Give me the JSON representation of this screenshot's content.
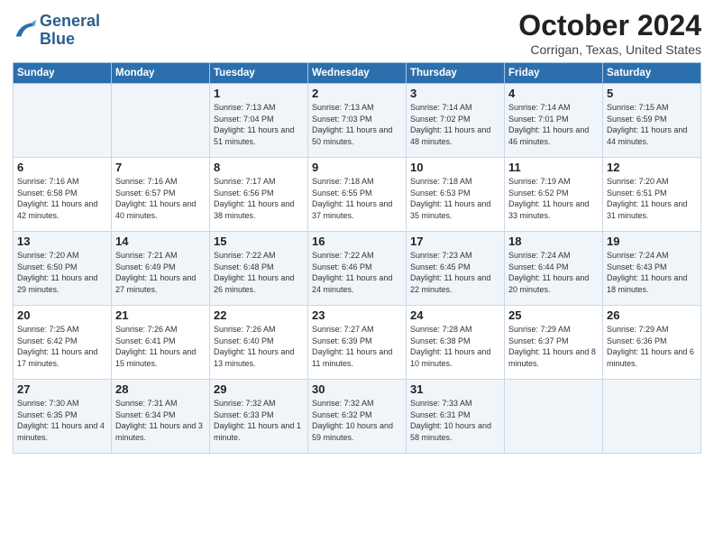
{
  "logo": {
    "line1": "General",
    "line2": "Blue"
  },
  "title": "October 2024",
  "subtitle": "Corrigan, Texas, United States",
  "days_of_week": [
    "Sunday",
    "Monday",
    "Tuesday",
    "Wednesday",
    "Thursday",
    "Friday",
    "Saturday"
  ],
  "weeks": [
    [
      {
        "num": "",
        "info": ""
      },
      {
        "num": "",
        "info": ""
      },
      {
        "num": "1",
        "info": "Sunrise: 7:13 AM\nSunset: 7:04 PM\nDaylight: 11 hours and 51 minutes."
      },
      {
        "num": "2",
        "info": "Sunrise: 7:13 AM\nSunset: 7:03 PM\nDaylight: 11 hours and 50 minutes."
      },
      {
        "num": "3",
        "info": "Sunrise: 7:14 AM\nSunset: 7:02 PM\nDaylight: 11 hours and 48 minutes."
      },
      {
        "num": "4",
        "info": "Sunrise: 7:14 AM\nSunset: 7:01 PM\nDaylight: 11 hours and 46 minutes."
      },
      {
        "num": "5",
        "info": "Sunrise: 7:15 AM\nSunset: 6:59 PM\nDaylight: 11 hours and 44 minutes."
      }
    ],
    [
      {
        "num": "6",
        "info": "Sunrise: 7:16 AM\nSunset: 6:58 PM\nDaylight: 11 hours and 42 minutes."
      },
      {
        "num": "7",
        "info": "Sunrise: 7:16 AM\nSunset: 6:57 PM\nDaylight: 11 hours and 40 minutes."
      },
      {
        "num": "8",
        "info": "Sunrise: 7:17 AM\nSunset: 6:56 PM\nDaylight: 11 hours and 38 minutes."
      },
      {
        "num": "9",
        "info": "Sunrise: 7:18 AM\nSunset: 6:55 PM\nDaylight: 11 hours and 37 minutes."
      },
      {
        "num": "10",
        "info": "Sunrise: 7:18 AM\nSunset: 6:53 PM\nDaylight: 11 hours and 35 minutes."
      },
      {
        "num": "11",
        "info": "Sunrise: 7:19 AM\nSunset: 6:52 PM\nDaylight: 11 hours and 33 minutes."
      },
      {
        "num": "12",
        "info": "Sunrise: 7:20 AM\nSunset: 6:51 PM\nDaylight: 11 hours and 31 minutes."
      }
    ],
    [
      {
        "num": "13",
        "info": "Sunrise: 7:20 AM\nSunset: 6:50 PM\nDaylight: 11 hours and 29 minutes."
      },
      {
        "num": "14",
        "info": "Sunrise: 7:21 AM\nSunset: 6:49 PM\nDaylight: 11 hours and 27 minutes."
      },
      {
        "num": "15",
        "info": "Sunrise: 7:22 AM\nSunset: 6:48 PM\nDaylight: 11 hours and 26 minutes."
      },
      {
        "num": "16",
        "info": "Sunrise: 7:22 AM\nSunset: 6:46 PM\nDaylight: 11 hours and 24 minutes."
      },
      {
        "num": "17",
        "info": "Sunrise: 7:23 AM\nSunset: 6:45 PM\nDaylight: 11 hours and 22 minutes."
      },
      {
        "num": "18",
        "info": "Sunrise: 7:24 AM\nSunset: 6:44 PM\nDaylight: 11 hours and 20 minutes."
      },
      {
        "num": "19",
        "info": "Sunrise: 7:24 AM\nSunset: 6:43 PM\nDaylight: 11 hours and 18 minutes."
      }
    ],
    [
      {
        "num": "20",
        "info": "Sunrise: 7:25 AM\nSunset: 6:42 PM\nDaylight: 11 hours and 17 minutes."
      },
      {
        "num": "21",
        "info": "Sunrise: 7:26 AM\nSunset: 6:41 PM\nDaylight: 11 hours and 15 minutes."
      },
      {
        "num": "22",
        "info": "Sunrise: 7:26 AM\nSunset: 6:40 PM\nDaylight: 11 hours and 13 minutes."
      },
      {
        "num": "23",
        "info": "Sunrise: 7:27 AM\nSunset: 6:39 PM\nDaylight: 11 hours and 11 minutes."
      },
      {
        "num": "24",
        "info": "Sunrise: 7:28 AM\nSunset: 6:38 PM\nDaylight: 11 hours and 10 minutes."
      },
      {
        "num": "25",
        "info": "Sunrise: 7:29 AM\nSunset: 6:37 PM\nDaylight: 11 hours and 8 minutes."
      },
      {
        "num": "26",
        "info": "Sunrise: 7:29 AM\nSunset: 6:36 PM\nDaylight: 11 hours and 6 minutes."
      }
    ],
    [
      {
        "num": "27",
        "info": "Sunrise: 7:30 AM\nSunset: 6:35 PM\nDaylight: 11 hours and 4 minutes."
      },
      {
        "num": "28",
        "info": "Sunrise: 7:31 AM\nSunset: 6:34 PM\nDaylight: 11 hours and 3 minutes."
      },
      {
        "num": "29",
        "info": "Sunrise: 7:32 AM\nSunset: 6:33 PM\nDaylight: 11 hours and 1 minute."
      },
      {
        "num": "30",
        "info": "Sunrise: 7:32 AM\nSunset: 6:32 PM\nDaylight: 10 hours and 59 minutes."
      },
      {
        "num": "31",
        "info": "Sunrise: 7:33 AM\nSunset: 6:31 PM\nDaylight: 10 hours and 58 minutes."
      },
      {
        "num": "",
        "info": ""
      },
      {
        "num": "",
        "info": ""
      }
    ]
  ]
}
